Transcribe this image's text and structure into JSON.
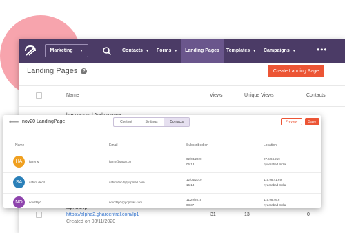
{
  "colors": {
    "nav_bg": "#4b3b66",
    "nav_active": "#6a568c",
    "accent": "#ec5535",
    "link": "#3a7bd5",
    "blob": "#f7a4ad"
  },
  "topnav": {
    "workspace": "Marketing",
    "items": [
      {
        "label": "Contacts",
        "chevron": true
      },
      {
        "label": "Forms",
        "chevron": true
      },
      {
        "label": "Landing Pages",
        "chevron": false,
        "active": true
      },
      {
        "label": "Templates",
        "chevron": true
      },
      {
        "label": "Campaigns",
        "chevron": true
      }
    ],
    "more": "•••"
  },
  "page": {
    "title": "Landing Pages",
    "help": "?",
    "create_button": "Create Landing Page",
    "columns": {
      "name": "Name",
      "views": "Views",
      "unique_views": "Unique Views",
      "contacts": "Contacts"
    },
    "peek_row_name": "live custom | Anding page",
    "bottom_row": {
      "name": "alpha 2 lp",
      "url": "https://alpha2.gharcentral.com/lp1",
      "created": "Created on 03/11/2020",
      "views": "31",
      "unique_views": "13",
      "contacts": "0"
    }
  },
  "modal": {
    "title": "nov20 LandingPage",
    "tabs": [
      "Content",
      "Settings",
      "Contacts"
    ],
    "active_tab": "Contacts",
    "preview_label": "Preview",
    "save_label": "Save",
    "columns": {
      "name": "Name",
      "email": "Email",
      "subscribed": "Subscribed on",
      "location": "Location"
    },
    "rows": [
      {
        "initials": "HA",
        "color": "#f0a020",
        "name": "harry M",
        "email": "harry@sagar.co",
        "date": "02/03/2020",
        "time": "06:13",
        "ip": "27.6.94.219",
        "city": "hyderabad India"
      },
      {
        "initials": "SA",
        "color": "#2b80b9",
        "name": "sahim dec4",
        "email": "sahimdec4@yopmail.com",
        "date": "12/04/2019",
        "time": "15:14",
        "ip": "115.98.41.69",
        "city": "hyderabad India"
      },
      {
        "initials": "NO",
        "color": "#8e44ad",
        "name": "nov29lp3",
        "email": "nov29lp3@yopmail.com",
        "date": "11/29/2019",
        "time": "08:37",
        "ip": "115.98.46.6",
        "city": "hyderabad India"
      }
    ]
  }
}
